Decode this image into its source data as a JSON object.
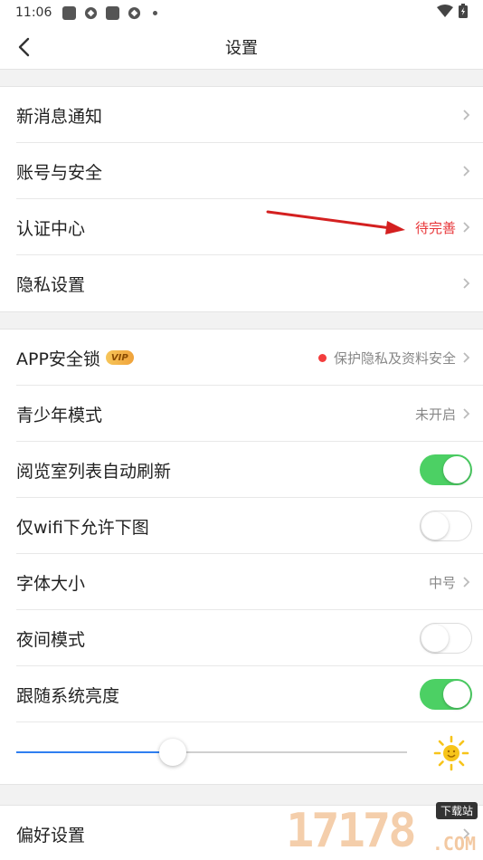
{
  "status_bar": {
    "time": "11:06"
  },
  "header": {
    "title": "设置"
  },
  "group1": [
    {
      "label": "新消息通知"
    },
    {
      "label": "账号与安全"
    },
    {
      "label": "认证中心",
      "value": "待完善"
    },
    {
      "label": "隐私设置"
    }
  ],
  "group2": {
    "app_lock": {
      "label": "APP安全锁",
      "badge": "VIP",
      "value": "保护隐私及资料安全"
    },
    "youth_mode": {
      "label": "青少年模式",
      "value": "未开启"
    },
    "auto_refresh": {
      "label": "阅览室列表自动刷新",
      "enabled": true
    },
    "wifi_images": {
      "label": "仅wifi下允许下图",
      "enabled": false
    },
    "font_size": {
      "label": "字体大小",
      "value": "中号"
    },
    "night_mode": {
      "label": "夜间模式",
      "enabled": false
    },
    "follow_brightness": {
      "label": "跟随系统亮度",
      "enabled": true
    },
    "brightness_level": 0.4
  },
  "group3": [
    {
      "label": "偏好设置"
    }
  ],
  "watermark": {
    "digits": "17178",
    "tag": "下载站",
    "domain": ".COM"
  },
  "colors": {
    "accent_blue": "#2f7ff0",
    "toggle_on": "#4cd064",
    "alert_red": "#e8373a"
  }
}
